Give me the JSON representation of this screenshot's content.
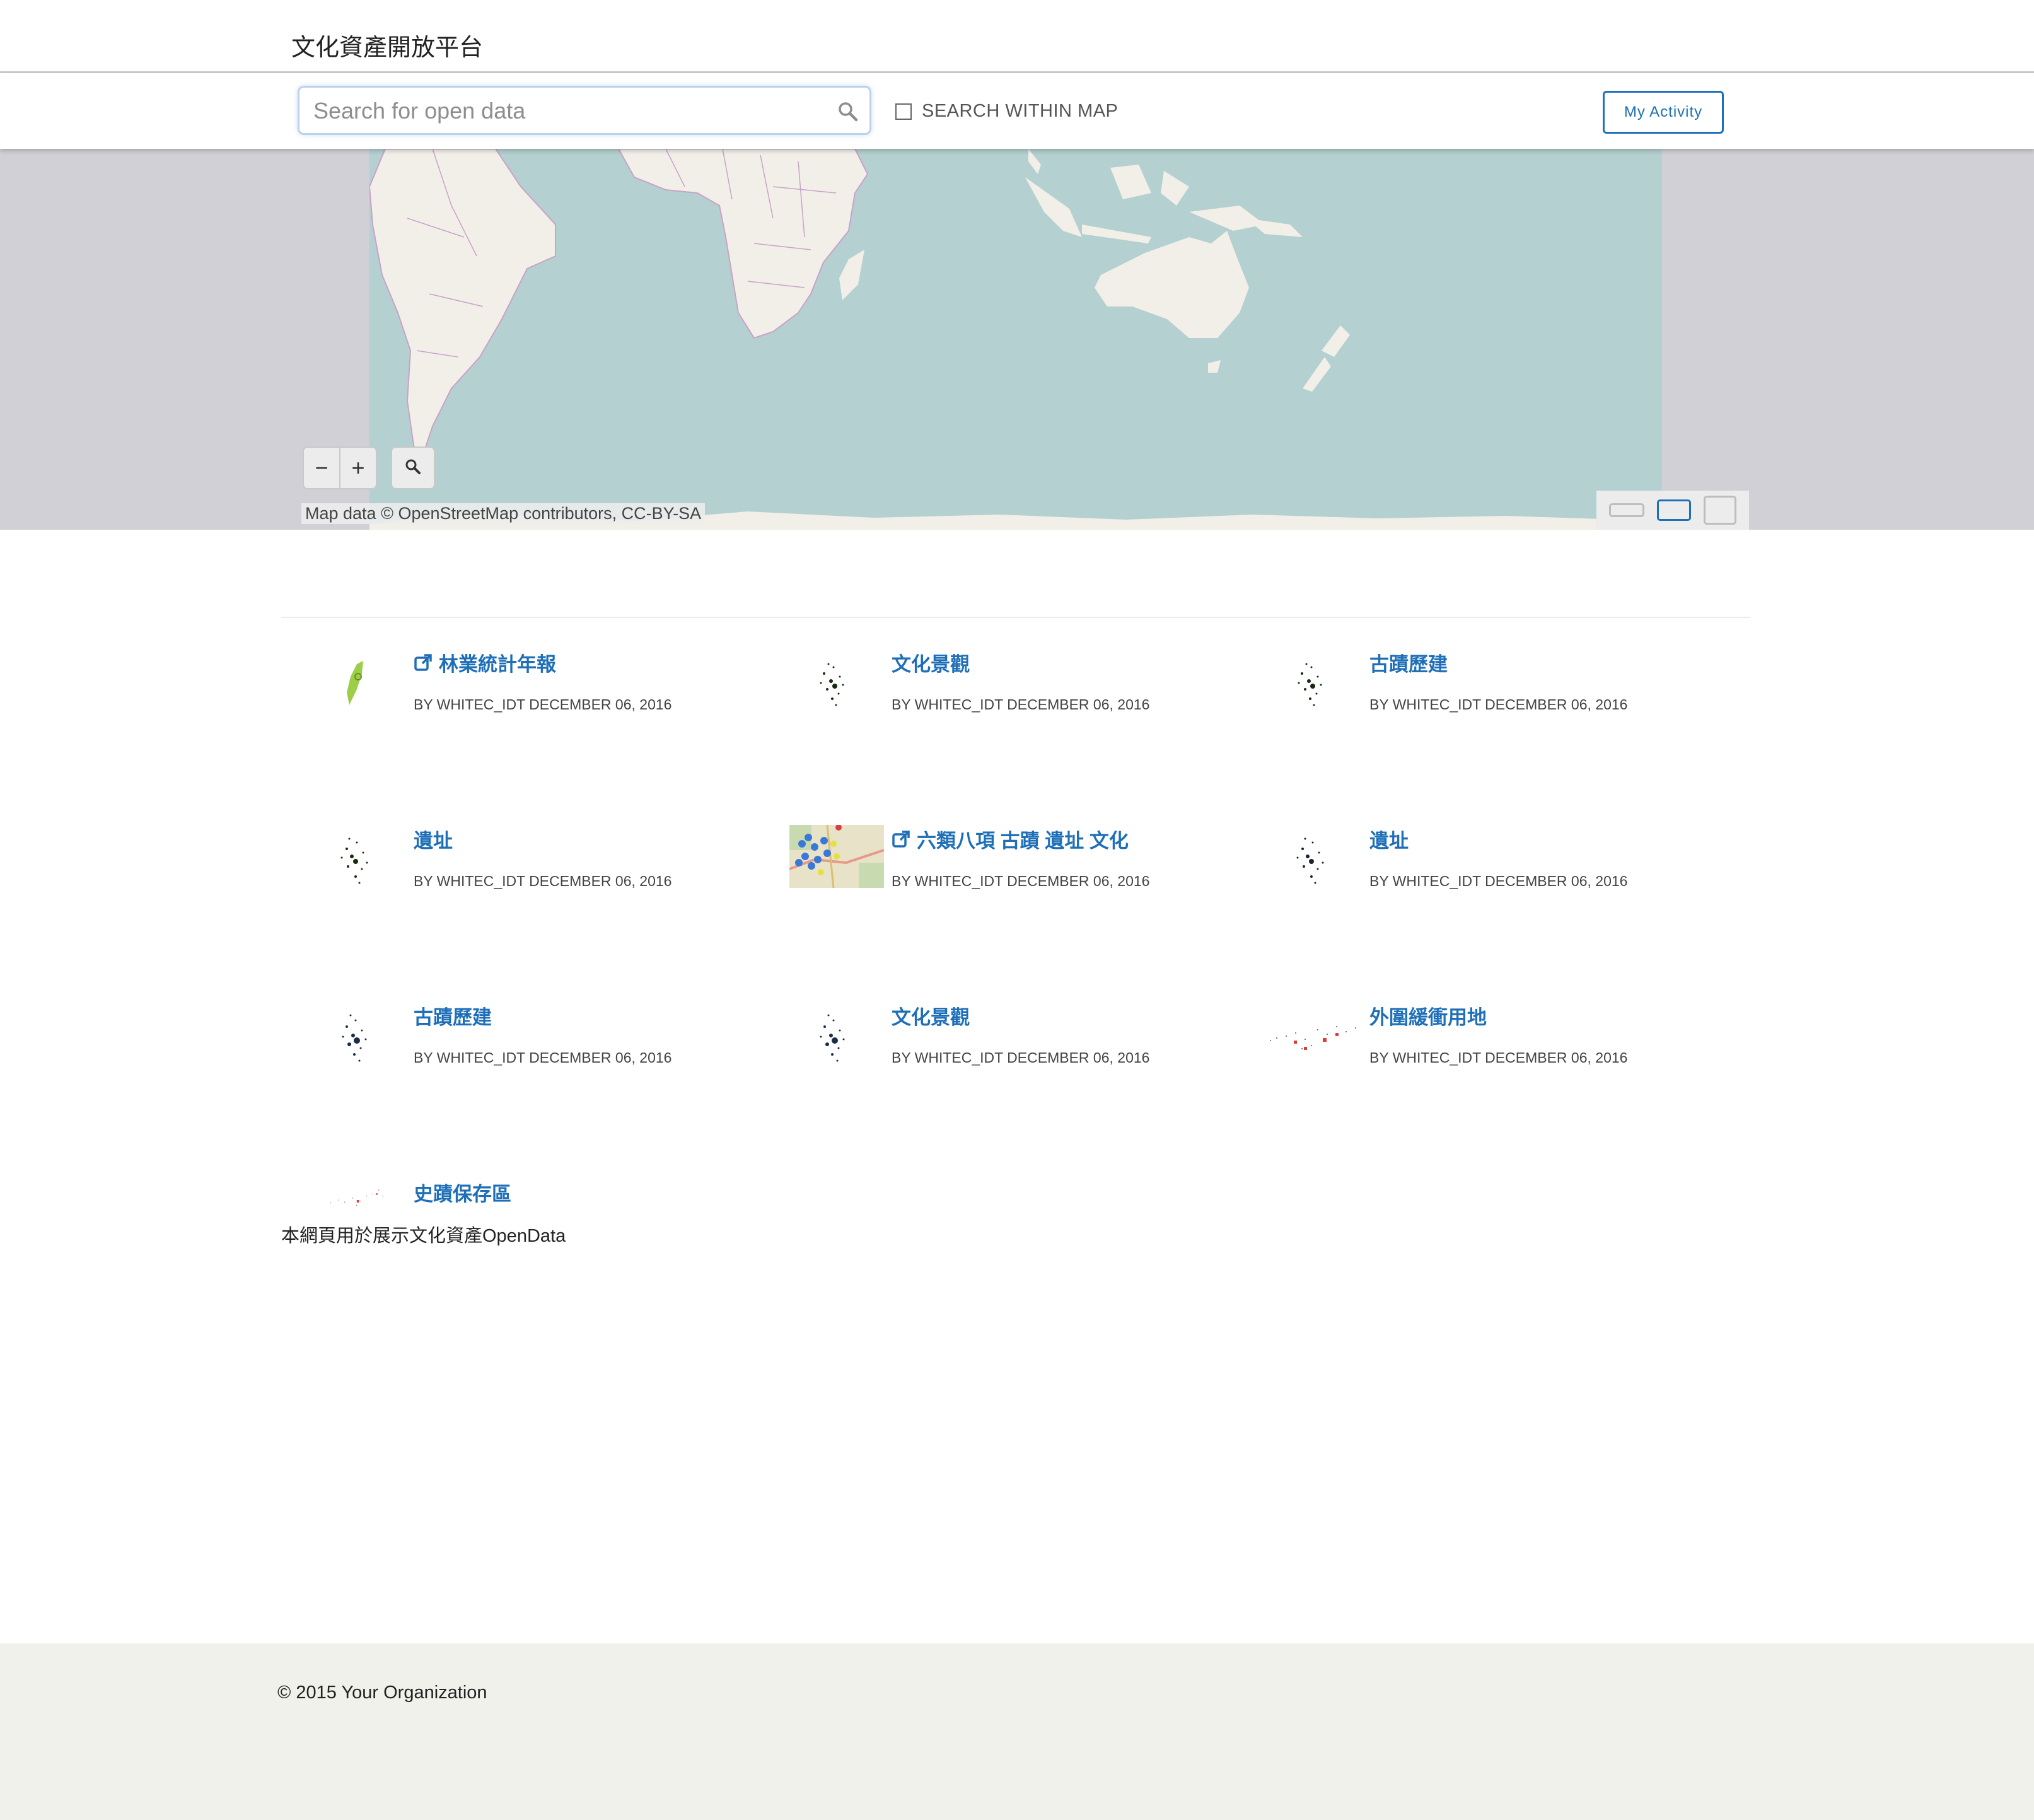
{
  "header": {
    "title": "文化資產開放平台"
  },
  "search": {
    "placeholder": "Search for open data",
    "value": "",
    "within_map_label": "SEARCH WITHIN MAP",
    "within_map_checked": false,
    "activity_label": "My Activity"
  },
  "map": {
    "zoom_out": "−",
    "zoom_in": "+",
    "attribution": "Map data © OpenStreetMap contributors, CC-BY-SA",
    "colors": {
      "water": "#b5d0d0",
      "land": "#f2efe9",
      "borders": "#c9a2c9",
      "outside": "#d0d0d6"
    },
    "view_options": [
      "small",
      "medium",
      "large"
    ],
    "selected_view": "medium"
  },
  "items": [
    {
      "title": "林業統計年報",
      "meta": "BY WHITEC_IDT DECEMBER 06, 2016",
      "external": true,
      "thumb": "taiwan-green-icon"
    },
    {
      "title": "文化景觀",
      "meta": "BY WHITEC_IDT DECEMBER 06, 2016",
      "external": false,
      "thumb": "scatter-dark-icon"
    },
    {
      "title": "古蹟歷建",
      "meta": "BY WHITEC_IDT DECEMBER 06, 2016",
      "external": false,
      "thumb": "scatter-dark-icon"
    },
    {
      "title": "遺址",
      "meta": "BY WHITEC_IDT DECEMBER 06, 2016",
      "external": false,
      "thumb": "scatter-dark-icon"
    },
    {
      "title": "六類八項 古蹟 遺址 文化",
      "meta": "BY WHITEC_IDT DECEMBER 06, 2016",
      "external": true,
      "thumb": "map-markers-icon"
    },
    {
      "title": "遺址",
      "meta": "BY WHITEC_IDT DECEMBER 06, 2016",
      "external": false,
      "thumb": "scatter-dark-icon"
    },
    {
      "title": "古蹟歷建",
      "meta": "BY WHITEC_IDT DECEMBER 06, 2016",
      "external": false,
      "thumb": "scatter-navy-icon"
    },
    {
      "title": "文化景觀",
      "meta": "BY WHITEC_IDT DECEMBER 06, 2016",
      "external": false,
      "thumb": "scatter-navy-icon"
    },
    {
      "title": "外圍緩衝用地",
      "meta": "BY WHITEC_IDT DECEMBER 06, 2016",
      "external": false,
      "thumb": "scatter-red-icon"
    },
    {
      "title": "史蹟保存區",
      "meta": "",
      "external": false,
      "thumb": "scatter-red-icon"
    }
  ],
  "description": "本網頁用於展示文化資產OpenData",
  "footer": {
    "copyright": "© 2015 Your Organization"
  },
  "colors": {
    "link": "#1e6fb8",
    "footer_bg": "#f1f1ec"
  }
}
